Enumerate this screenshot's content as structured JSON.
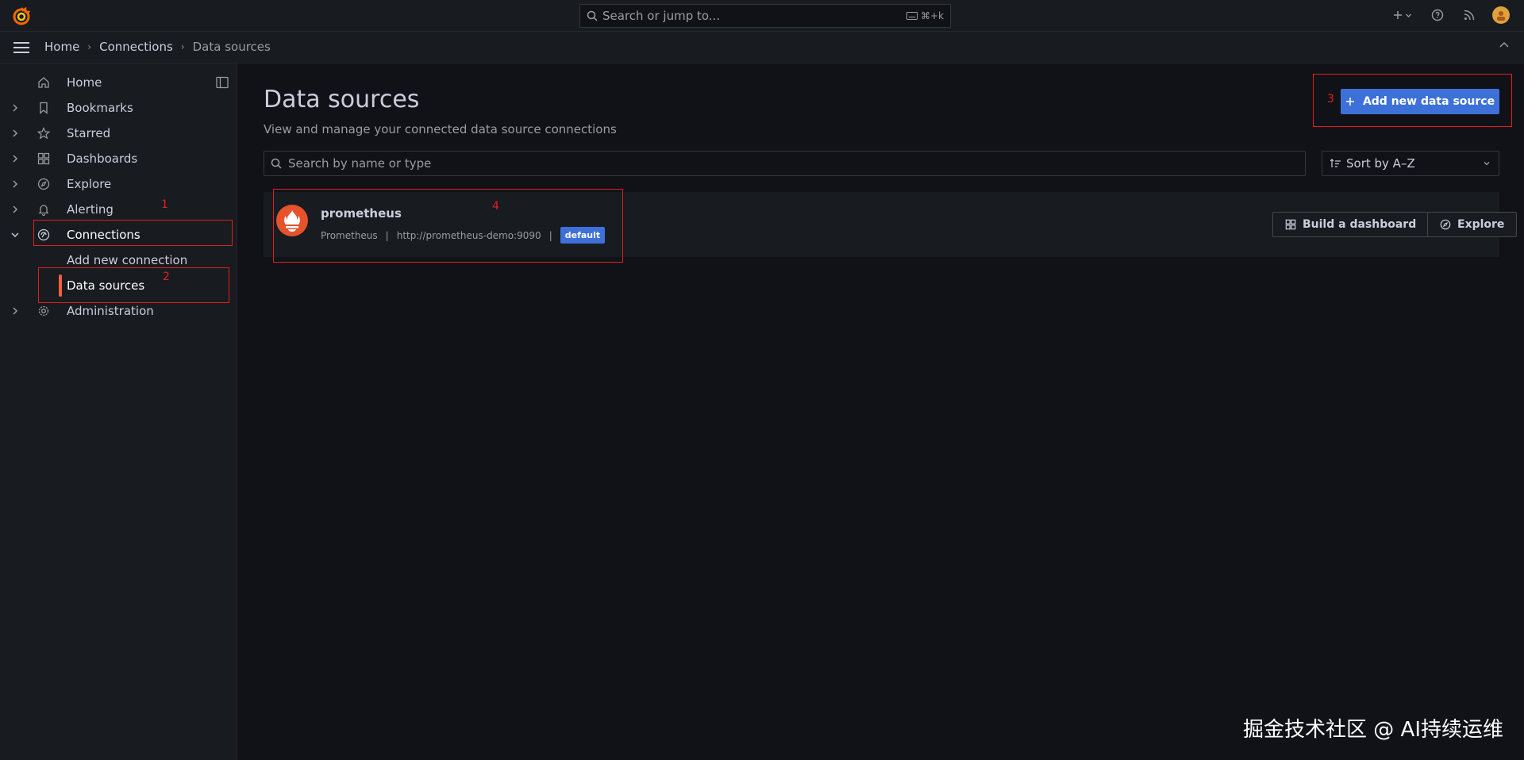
{
  "topbar": {
    "search_placeholder": "Search or jump to...",
    "shortcut": "⌘+k"
  },
  "breadcrumb": [
    {
      "label": "Home"
    },
    {
      "label": "Connections"
    },
    {
      "label": "Data sources"
    }
  ],
  "sidebar": {
    "items": [
      {
        "label": "Home",
        "icon": "home-icon"
      },
      {
        "label": "Bookmarks",
        "icon": "bookmark-icon"
      },
      {
        "label": "Starred",
        "icon": "star-icon"
      },
      {
        "label": "Dashboards",
        "icon": "dashboards-icon"
      },
      {
        "label": "Explore",
        "icon": "compass-icon"
      },
      {
        "label": "Alerting",
        "icon": "bell-icon"
      },
      {
        "label": "Connections",
        "icon": "connections-icon"
      },
      {
        "label": "Administration",
        "icon": "gear-icon"
      }
    ],
    "sub_items": [
      {
        "label": "Add new connection"
      },
      {
        "label": "Data sources"
      }
    ]
  },
  "annotations": {
    "n1": "1",
    "n2": "2",
    "n3": "3",
    "n4": "4"
  },
  "main": {
    "title": "Data sources",
    "subtitle": "View and manage your connected data source connections",
    "add_button": "Add new data source",
    "search_placeholder": "Search by name or type",
    "sort_label": "Sort by A–Z"
  },
  "datasources": [
    {
      "name": "prometheus",
      "type": "Prometheus",
      "url": "http://prometheus-demo:9090",
      "badge": "default",
      "build_button": "Build a dashboard",
      "explore_button": "Explore"
    }
  ],
  "watermark": "掘金技术社区 @ AI持续运维",
  "colors": {
    "accent": "#3d71d9",
    "active": "#f55f3e",
    "annotation": "#e02020",
    "background": "#111217"
  }
}
